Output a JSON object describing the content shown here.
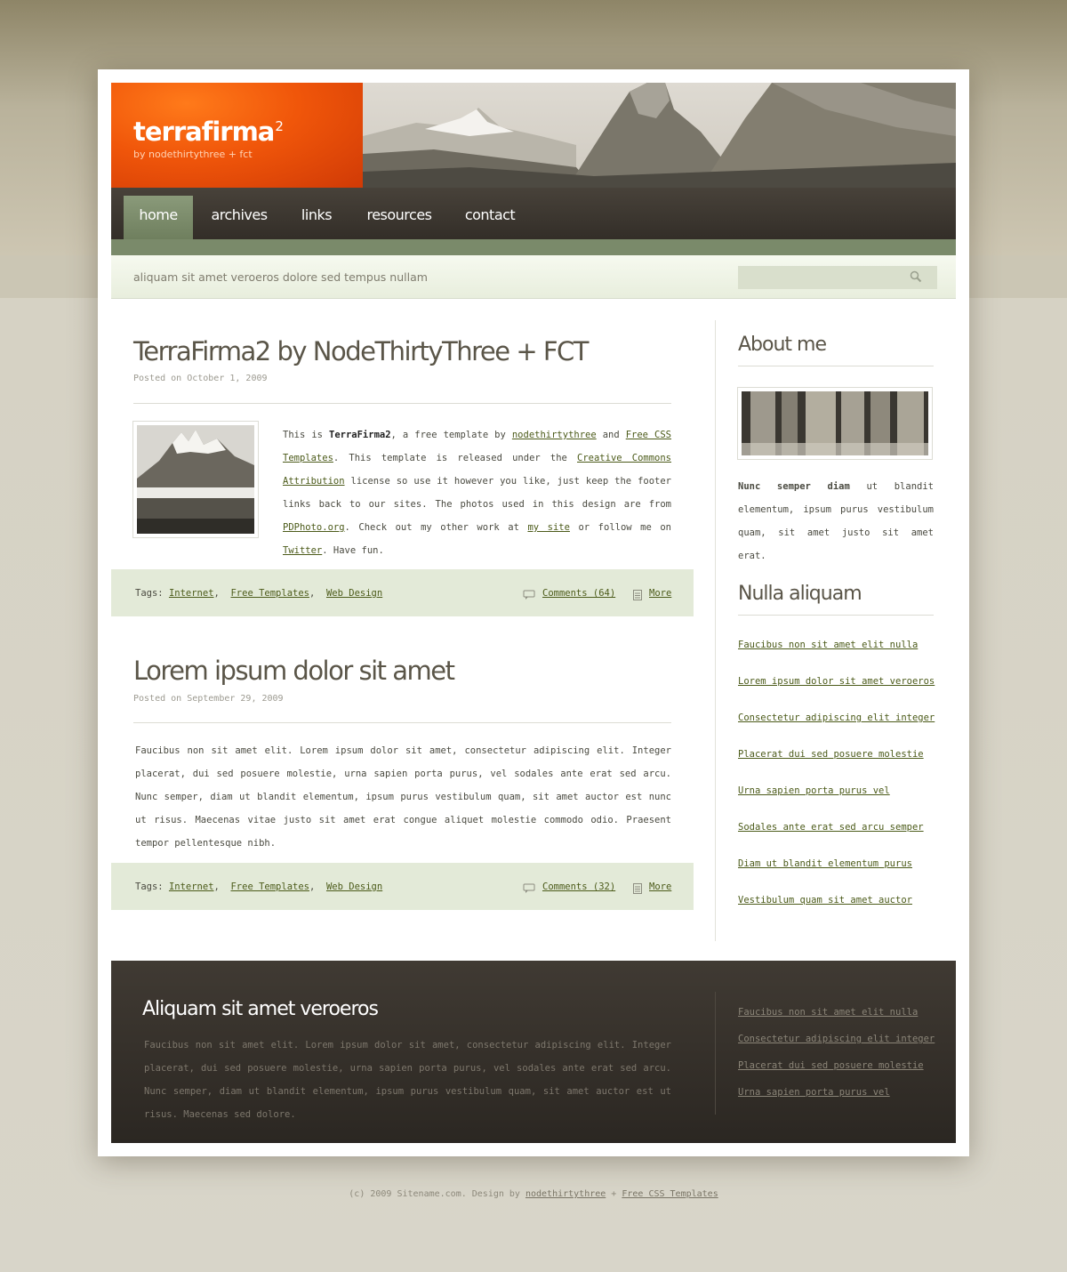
{
  "header": {
    "logo_title": "terrafirma",
    "logo_sup": "2",
    "logo_sub": "by nodethirtythree + fct"
  },
  "nav": {
    "items": [
      "home",
      "archives",
      "links",
      "resources",
      "contact"
    ],
    "active": "home"
  },
  "subbar": {
    "tagline": "aliquam sit amet veroeros dolore sed tempus nullam",
    "search_placeholder": ""
  },
  "posts": [
    {
      "title": "TerraFirma2 by NodeThirtyThree + FCT",
      "date": "Posted on October 1, 2009",
      "body": {
        "t1": "This is ",
        "b1": "TerraFirma2",
        "t2": ", a free template by ",
        "l1": "nodethirtythree",
        "t3": " and ",
        "l2": "Free CSS Templates",
        "t4": ".  This template is released under the ",
        "l3": "Creative Commons Attribution",
        "t5": " license so use it however you like, just keep the footer links back to our sites. The photos used in this design are from ",
        "l4": "PDPhoto.org",
        "t6": ". Check out my other work at ",
        "l5": "my site",
        "t7": " or follow me on ",
        "l6": "Twitter",
        "t8": ". Have fun."
      },
      "tags_label": "Tags:",
      "tags": [
        "Internet",
        "Free Templates",
        "Web Design"
      ],
      "comments": "Comments (64)",
      "more": "More"
    },
    {
      "title": "Lorem ipsum dolor sit amet",
      "date": "Posted on September 29, 2009",
      "body_text": "Faucibus non sit amet elit. Lorem ipsum dolor sit amet, consectetur adipiscing elit. Integer placerat, dui sed posuere molestie, urna sapien porta purus, vel sodales ante erat sed arcu. Nunc semper, diam ut blandit elementum, ipsum purus vestibulum quam, sit amet auctor est nunc ut risus. Maecenas vitae justo sit amet erat congue aliquet molestie commodo odio. Praesent tempor pellentesque nibh.",
      "tags_label": "Tags:",
      "tags": [
        "Internet",
        "Free Templates",
        "Web Design"
      ],
      "comments": "Comments (32)",
      "more": "More"
    }
  ],
  "sidebar": {
    "about_title": "About me",
    "about_bold": "Nunc semper diam",
    "about_text": " ut blandit elementum, ipsum purus vestibulum quam, sit amet justo sit amet erat.",
    "links_title": "Nulla aliquam",
    "links": [
      "Faucibus non sit amet elit nulla",
      "Lorem ipsum dolor sit amet veroeros",
      "Consectetur adipiscing elit integer",
      "Placerat dui sed posuere molestie",
      "Urna sapien porta purus vel",
      "Sodales ante erat sed arcu semper",
      "Diam ut blandit elementum purus",
      "Vestibulum quam sit amet auctor"
    ]
  },
  "footer": {
    "title": "Aliquam sit amet veroeros",
    "text": "Faucibus non sit amet elit. Lorem ipsum dolor sit amet, consectetur adipiscing elit. Integer placerat, dui sed posuere molestie, urna sapien porta purus, vel sodales ante erat sed arcu. Nunc semper, diam ut blandit elementum, ipsum purus vestibulum quam, sit amet auctor est ut risus. Maecenas sed dolore.",
    "links": [
      "Faucibus non sit amet elit nulla",
      "Consectetur adipiscing elit integer",
      "Placerat dui sed posuere molestie",
      "Urna sapien porta purus vel"
    ]
  },
  "copyright": {
    "prefix": "(c) 2009 Sitename.com. Design by ",
    "link1": "nodethirtythree",
    "mid": " + ",
    "link2": "Free CSS Templates"
  },
  "colors": {
    "accent_orange": "#f0560a",
    "nav_dark": "#3d3731",
    "nav_active_green": "#7d8d6c",
    "link_olive": "#4c5b1a",
    "post_footer_bg": "#e3ead8"
  }
}
